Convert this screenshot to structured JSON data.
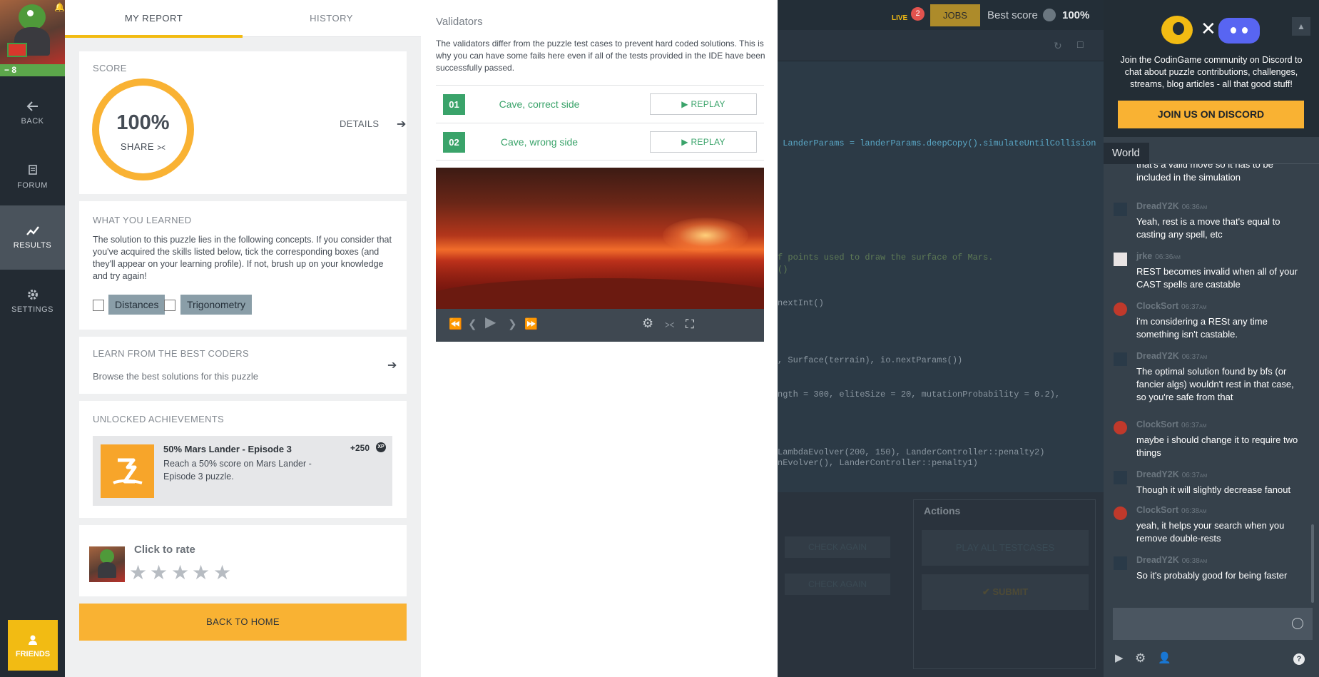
{
  "nav": {
    "level": "8",
    "level_progress": 1.0,
    "items": [
      {
        "label": "BACK",
        "icon": "arrow-left-icon"
      },
      {
        "label": "FORUM",
        "icon": "forum-icon"
      },
      {
        "label": "RESULTS",
        "icon": "results-chart-icon",
        "active": true
      },
      {
        "label": "SETTINGS",
        "icon": "gear-icon"
      }
    ],
    "friends_label": "FRIENDS"
  },
  "report": {
    "tabs": [
      {
        "label": "MY REPORT",
        "active": true
      },
      {
        "label": "HISTORY",
        "active": false
      }
    ],
    "score": {
      "title": "SCORE",
      "value": "100%",
      "share_label": "SHARE",
      "details_label": "DETAILS"
    },
    "learned": {
      "title": "WHAT YOU LEARNED",
      "description": "The solution to this puzzle lies in the following concepts. If you consider that you've acquired the skills listed below, tick the corresponding boxes (and they'll appear on your learning profile). If not, brush up on your knowledge and try again!",
      "concepts": [
        "Distances",
        "Trigonometry"
      ]
    },
    "best_coders": {
      "title": "LEARN FROM THE BEST CODERS",
      "description": "Browse the best solutions for this puzzle"
    },
    "achievements": {
      "title": "UNLOCKED ACHIEVEMENTS",
      "items": [
        {
          "name": "50% Mars Lander - Episode 3",
          "description": "Reach a 50% score on Mars Lander - Episode 3 puzzle.",
          "xp": "+250",
          "xp_badge": "XP"
        }
      ]
    },
    "rating": {
      "label": "Click to rate",
      "stars": 5
    },
    "back_home_label": "BACK TO HOME"
  },
  "validators": {
    "title": "Validators",
    "description": "The validators differ from the puzzle test cases to prevent hard coded solutions. This is why you can have some fails here even if all of the tests provided in the IDE have been successfully passed.",
    "items": [
      {
        "number": "01",
        "name": "Cave, correct side",
        "replay_label": "REPLAY"
      },
      {
        "number": "02",
        "name": "Cave, wrong side",
        "replay_label": "REPLAY"
      }
    ]
  },
  "ide": {
    "live_count": "2",
    "live_label": "LIVE",
    "jobs_label": "JOBS",
    "best_score_label": "Best score",
    "best_score_value": "100%",
    "code_lines": [
      {
        "text": " LanderParams = landerParams.deepCopy().simulateUntilCollision",
        "kind": "type"
      },
      {
        "text": "f points used to draw the surface of Mars.",
        "kind": "comment"
      },
      {
        "text": "()",
        "kind": "comment"
      },
      {
        "text": "nextInt()",
        "kind": "plain"
      },
      {
        "text": ", Surface(terrain), io.nextParams())",
        "kind": "plain"
      },
      {
        "text": "ngth = 300, eliteSize = 20, mutationProbability = 0.2),",
        "kind": "plain"
      },
      {
        "text": "LambdaEvolver(200, 150), LanderController::penalty2)",
        "kind": "plain"
      },
      {
        "text": "nEvolver(), LanderController::penalty1)",
        "kind": "plain"
      }
    ],
    "actions_title": "Actions",
    "check_again_label": "CHECK AGAIN",
    "play_all_label": "PLAY ALL TESTCASES",
    "submit_label": "SUBMIT"
  },
  "chat": {
    "discord_text": "Join the CodinGame community on Discord to chat about puzzle contributions, challenges, streams, blog articles - all that good stuff!",
    "discord_button": "JOIN US ON DISCORD",
    "tab_label": "World",
    "messages": [
      {
        "user": "",
        "time": "",
        "text": "that's a valid move so it has to be included in the simulation"
      },
      {
        "user": "DreadY2K",
        "time": "06:36",
        "time_suffix": "AM",
        "text": "Yeah, rest is a move that's equal to casting any spell, etc"
      },
      {
        "user": "jrke",
        "time": "06:36",
        "time_suffix": "AM",
        "text": "REST becomes invalid when all of your CAST spells are castable"
      },
      {
        "user": "ClockSort",
        "time": "06:37",
        "time_suffix": "AM",
        "text": "i'm considering a RESt any time something isn't castable."
      },
      {
        "user": "DreadY2K",
        "time": "06:37",
        "time_suffix": "AM",
        "text": "The optimal solution found by bfs (or fancier algs) wouldn't rest in that case, so you're safe from that"
      },
      {
        "user": "ClockSort",
        "time": "06:37",
        "time_suffix": "AM",
        "text": "maybe i should change it to require two things"
      },
      {
        "user": "DreadY2K",
        "time": "06:37",
        "time_suffix": "AM",
        "text": "Though it will slightly decrease fanout"
      },
      {
        "user": "ClockSort",
        "time": "06:38",
        "time_suffix": "AM",
        "text": "yeah, it helps your search when you  remove double-rests"
      },
      {
        "user": "DreadY2K",
        "time": "06:38",
        "time_suffix": "AM",
        "text": "So it's probably good for being faster"
      }
    ]
  },
  "colors": {
    "accent": "#f9b233",
    "success": "#3aa36a",
    "nav_bg": "#232b33",
    "chat_bg": "#36414b",
    "discord": "#5865f2"
  }
}
